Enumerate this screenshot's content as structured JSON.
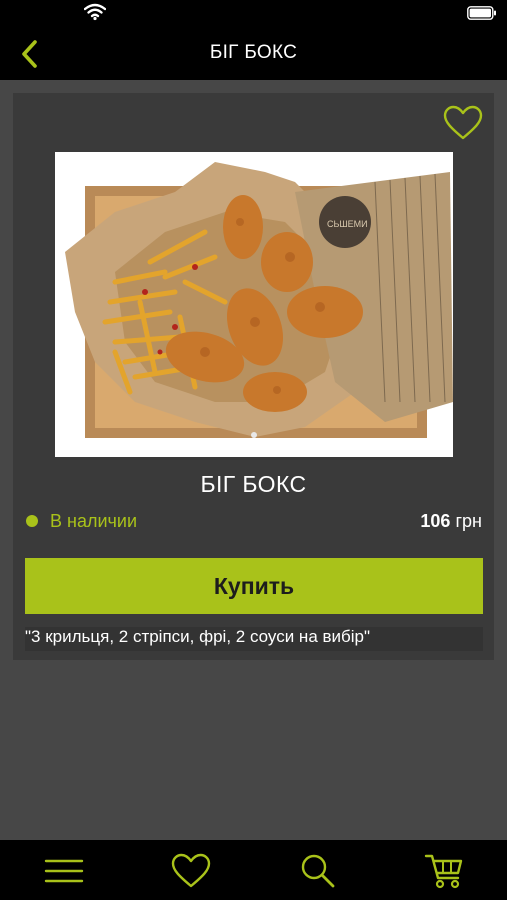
{
  "status_bar": {
    "icons": [
      "wifi-icon",
      "battery-icon"
    ]
  },
  "nav": {
    "title": "БІГ БОКС",
    "back_icon": "chevron-left-icon"
  },
  "product": {
    "image": "food-photo",
    "name": "БІГ БОКС",
    "availability": "В наличии",
    "price_value": "106",
    "price_currency": "грн",
    "buy_label": "Купить",
    "description": "\"3 крильця, 2 стріпси, фрі, 2 соуси на вибір\"",
    "favorite_icon": "heart-outline-icon"
  },
  "tab_bar": {
    "items": [
      "menu-icon",
      "heart-icon",
      "search-icon",
      "cart-icon"
    ]
  },
  "colors": {
    "accent": "#a9c21a",
    "background": "#474747",
    "card": "#3a3a3a",
    "bars": "#000000"
  }
}
